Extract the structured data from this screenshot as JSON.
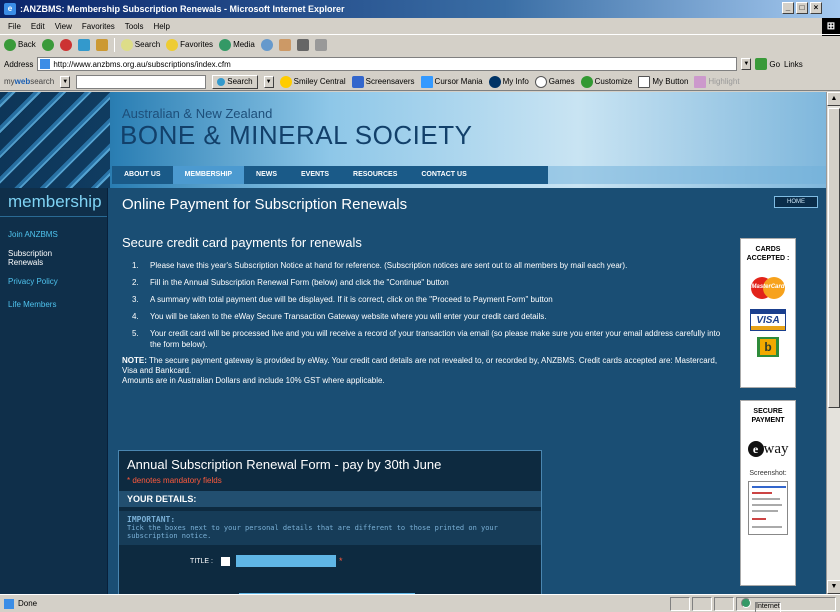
{
  "window": {
    "title": ":ANZBMS: Membership Subscription Renewals - Microsoft Internet Explorer",
    "controls": [
      "_",
      "□",
      "×"
    ]
  },
  "menu": [
    "File",
    "Edit",
    "View",
    "Favorites",
    "Tools",
    "Help"
  ],
  "toolbar": {
    "back": "Back",
    "search": "Search",
    "favorites": "Favorites",
    "media": "Media"
  },
  "address": {
    "label": "Address",
    "url": "http://www.anzbms.org.au/subscriptions/index.cfm",
    "go": "Go",
    "links": "Links"
  },
  "searchbar": {
    "brand_prefix": "my",
    "brand_bold": "web",
    "brand_suffix": "search",
    "search_btn": "Search",
    "items": [
      "Smiley Central",
      "Screensavers",
      "Cursor Mania",
      "My Info",
      "Games",
      "Customize",
      "My Button",
      "Highlight"
    ]
  },
  "site": {
    "subtitle": "Australian & New Zealand",
    "title": "BONE & MINERAL SOCIETY",
    "nav": [
      "ABOUT US",
      "MEMBERSHIP",
      "NEWS",
      "EVENTS",
      "RESOURCES",
      "CONTACT US"
    ],
    "nav_active": 1
  },
  "sidebar": {
    "title": "membership",
    "items": [
      {
        "label": "Join ANZBMS",
        "current": false
      },
      {
        "label": "Subscription Renewals",
        "current": true
      },
      {
        "label": "Privacy Policy",
        "current": false
      },
      {
        "label": "Life Members",
        "current": false
      }
    ]
  },
  "content": {
    "title": "Online Payment for Subscription Renewals",
    "subtitle": "Secure credit card payments for renewals",
    "steps": [
      "Please have this year's Subscription Notice at hand for reference. (Subscription notices are sent out to all members by mail each year).",
      "Fill in the Annual Subscription Renewal Form (below) and click the \"Continue\" button",
      "A summary with total payment due will be displayed. If it is correct, click on the \"Proceed to Payment Form\" button",
      "You will be taken to the eWay Secure Transaction Gateway website where you will enter your credit card details.",
      "Your credit card will be processed live and you will receive a record of your transaction via email (so please make sure you enter your email address carefully into the form below)."
    ],
    "note_label": "NOTE:",
    "note_text": " The secure payment gateway is provided by eWay. Your credit card details are not revealed to, or recorded by, ANZBMS. Credit cards accepted are: Mastercard, Visa and Bankcard.",
    "note_line2": "Amounts are in Australian Dollars and include 10% GST where applicable."
  },
  "form": {
    "title": "Annual Subscription Renewal Form - pay by 30th June",
    "mandatory": "* denotes mandatory fields",
    "section": "YOUR DETAILS:",
    "important_head": "IMPORTANT:",
    "important_text": "Tick the boxes next to your personal details that are different to those printed on your subscription notice.",
    "title_label": "TITLE",
    "req": "*"
  },
  "right": {
    "home": "HOME",
    "cards_head": "CARDS ACCEPTED :",
    "mastercard": "MasterCard",
    "visa": "VISA",
    "bankcard": "b",
    "secure_head": "SECURE PAYMENT",
    "eway_e": "e",
    "eway": "way",
    "screenshot_label": "Screenshot:"
  },
  "status": {
    "text": "Done",
    "zone": "Internet"
  }
}
